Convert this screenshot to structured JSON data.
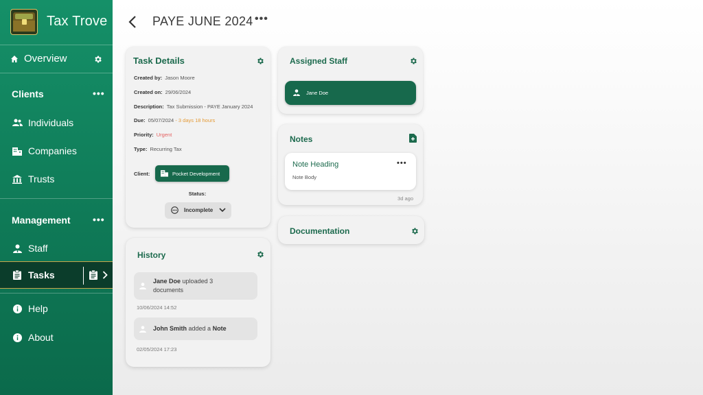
{
  "app": {
    "name": "Tax Trove"
  },
  "sidebar": {
    "overview": {
      "label": "Overview"
    },
    "clients": {
      "label": "Clients",
      "more": "•••",
      "items": [
        {
          "label": "Individuals",
          "icon": "people-icon"
        },
        {
          "label": "Companies",
          "icon": "building-icon"
        },
        {
          "label": "Trusts",
          "icon": "bank-icon"
        }
      ]
    },
    "management": {
      "label": "Management",
      "more": "•••",
      "items": [
        {
          "label": "Staff",
          "icon": "person-badge-icon"
        },
        {
          "label": "Tasks",
          "icon": "clipboard-icon",
          "active": true
        }
      ]
    },
    "footer": [
      {
        "label": "Help",
        "icon": "info-icon"
      },
      {
        "label": "About",
        "icon": "info-icon"
      }
    ]
  },
  "header": {
    "title": "PAYE JUNE 2024",
    "more": "•••"
  },
  "task_details": {
    "title": "Task Details",
    "created_by_label": "Created by:",
    "created_by": "Jason Moore",
    "created_on_label": "Created on:",
    "created_on": "29/06/2024",
    "description_label": "Description:",
    "description": "Tax Submission - PAYE January 2024",
    "due_label": "Due:",
    "due": "05/07/2024",
    "due_relative": "- 3 days 18 hours",
    "priority_label": "Priority:",
    "priority": "Urgent",
    "type_label": "Type:",
    "type": "Recurring Tax",
    "client_label": "Client:",
    "client": "Pocket Development",
    "status_label": "Status:",
    "status": "Incomplete"
  },
  "assigned_staff": {
    "title": "Assigned Staff",
    "staff": "Jane Doe"
  },
  "notes": {
    "title": "Notes",
    "items": [
      {
        "heading": "Note Heading",
        "body": "Note Body",
        "time": "3d ago",
        "more": "•••"
      }
    ]
  },
  "documentation": {
    "title": "Documentation"
  },
  "history": {
    "title": "History",
    "items": [
      {
        "actor": "Jane Doe",
        "line1": "uploaded 3",
        "line2": "documents",
        "time": "10/06/2024 14:52"
      },
      {
        "actor": "John Smith",
        "action": "added a",
        "object": "Note",
        "time": "02/05/2024 17:23"
      }
    ]
  },
  "colors": {
    "accent": "#17694c",
    "sidebar": "#0f7a57",
    "active": "#0b3d2b",
    "due": "#e49a36",
    "urgent": "#e46060"
  }
}
